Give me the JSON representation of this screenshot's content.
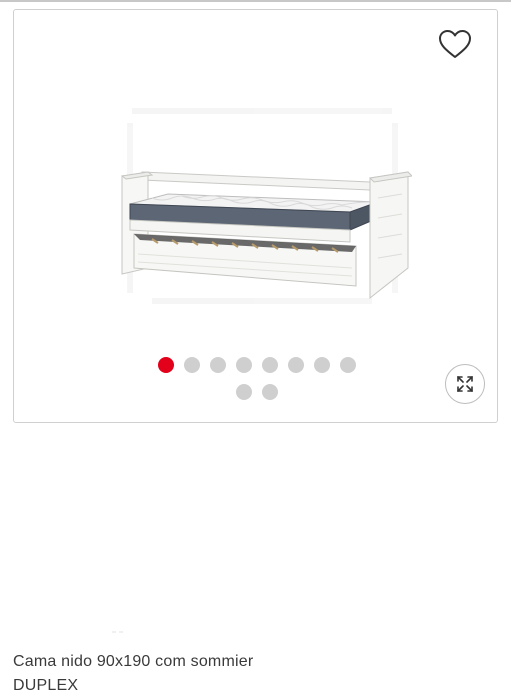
{
  "colors": {
    "active_dot": "#e2001a",
    "inactive_dot": "#cfcfcf",
    "card_border": "#d0d0d0",
    "title_text": "#3a3a3a"
  },
  "gallery": {
    "image_count": 10,
    "active_index": 1,
    "wishlist_icon": "heart-outline-icon",
    "expand_icon": "expand-arrows-icon",
    "image_description_icon": "bed-product-image"
  },
  "product": {
    "title_line1": "Cama nido 90x190 com sommier",
    "title_line2": "DUPLEX"
  }
}
